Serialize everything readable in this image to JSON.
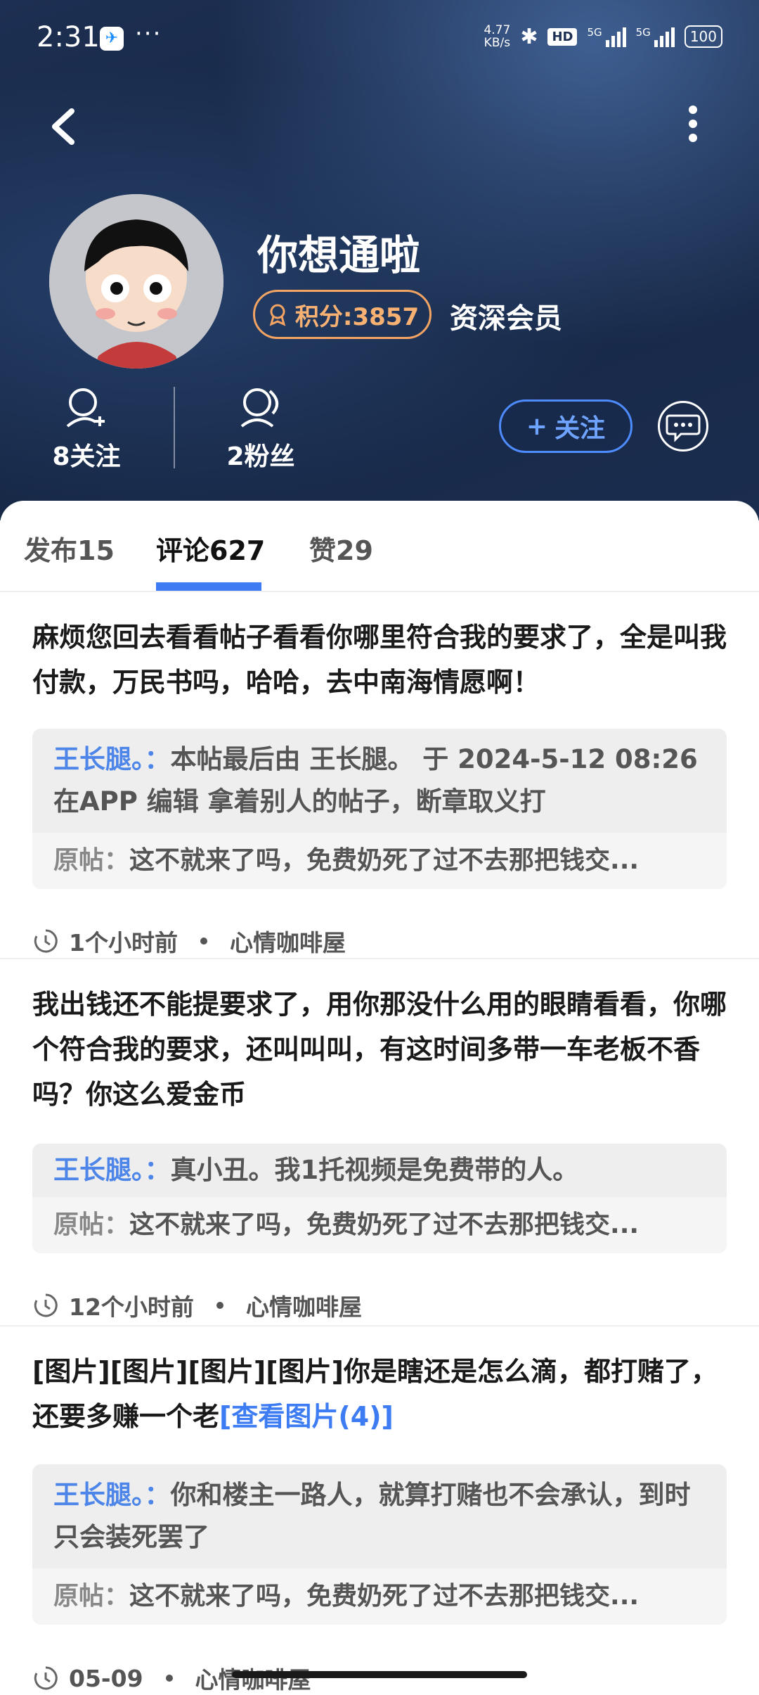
{
  "status_bar": {
    "time": "2:31",
    "net_speed_value": "4.77",
    "net_speed_unit": "KB/s",
    "hd_label": "HD",
    "signal_label_1": "5G",
    "signal_label_2": "5G",
    "battery": "100"
  },
  "profile": {
    "username": "你想通啦",
    "points_label": "积分:3857",
    "member_level": "资深会员",
    "following_label": "8关注",
    "followers_label": "2粉丝",
    "follow_button": "关注",
    "follow_plus": "+"
  },
  "tabs": [
    {
      "label": "发布15"
    },
    {
      "label": "评论627"
    },
    {
      "label": "赞29"
    }
  ],
  "active_tab": "评论627",
  "comments": [
    {
      "text": "麻烦您回去看看帖子看看你哪里符合我的要求了，全是叫我付款，万民书吗，哈哈，去中南海情愿啊！",
      "link": "",
      "reply_user": "王长腿。：",
      "reply_text": "本帖最后由 王长腿。 于 2024-5-12 08:26 在APP 编辑 拿着别人的帖子，断章取义打",
      "origin_label": "原帖：",
      "origin_text": "这不就来了吗，免费奶死了过不去那把钱交...",
      "time": "1个小时前",
      "board": "心情咖啡屋"
    },
    {
      "text": "我出钱还不能提要求了，用你那没什么用的眼睛看看，你哪个符合我的要求，还叫叫叫，有这时间多带一车老板不香吗？你这么爱金币",
      "link": "",
      "reply_user": "王长腿。：",
      "reply_text": "真小丑。我1托视频是免费带的人。",
      "origin_label": "原帖：",
      "origin_text": "这不就来了吗，免费奶死了过不去那把钱交...",
      "time": "12个小时前",
      "board": "心情咖啡屋"
    },
    {
      "text": "[图片][图片][图片][图片]你是瞎还是怎么滴，都打赌了，还要多赚一个老",
      "link": "[查看图片(4)]",
      "reply_user": "王长腿。：",
      "reply_text": "你和楼主一路人，就算打赌也不会承认，到时只会装死罢了",
      "origin_label": "原帖：",
      "origin_text": "这不就来了吗，免费奶死了过不去那把钱交...",
      "time": "05-09",
      "board": "心情咖啡屋"
    }
  ]
}
